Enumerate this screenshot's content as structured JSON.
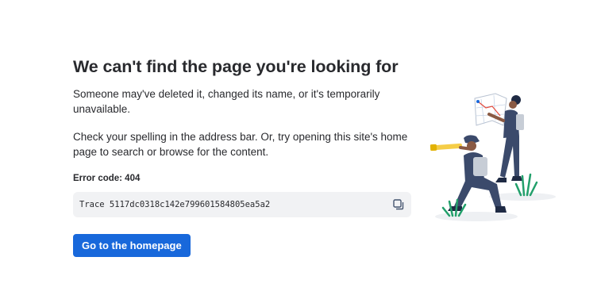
{
  "page": {
    "title": "We can't find the page you're looking for",
    "paragraph_1": "Someone may've deleted it, changed its name, or it's temporarily unavailable.",
    "paragraph_2": "Check your spelling in the address bar. Or, try opening this site's home page to search or browse for the content.",
    "error_code_label": "Error code: 404",
    "trace_text": "Trace 5117dc0318c142e799601584805ea5a2",
    "copy_icon": "copy-icon",
    "illustration_icon": "explorers-illustration"
  },
  "actions": {
    "home_button_label": "Go to the homepage"
  },
  "colors": {
    "primary_button": "#1868db",
    "text": "#292a2e",
    "trace_background": "#f1f2f4"
  }
}
